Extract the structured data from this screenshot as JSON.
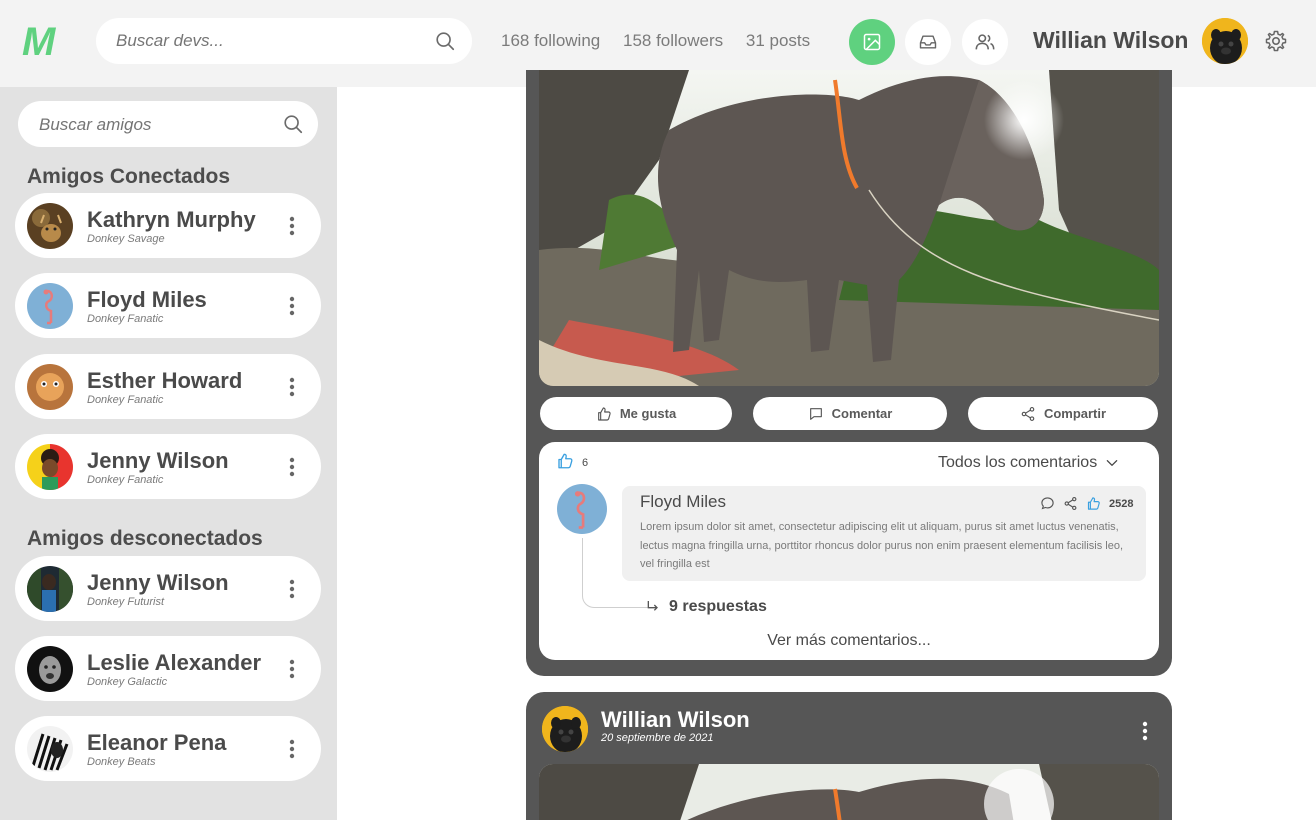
{
  "header": {
    "logo": "M",
    "search_placeholder": "Buscar devs...",
    "stats": {
      "following": "168 following",
      "followers": "158 followers",
      "posts": "31 posts"
    },
    "user_name": "Willian Wilson"
  },
  "sidebar": {
    "search_placeholder": "Buscar amigos",
    "connected_title": "Amigos Conectados",
    "disconnected_title": "Amigos desconectados",
    "connected": [
      {
        "name": "Kathryn Murphy",
        "subtitle": "Donkey Savage"
      },
      {
        "name": "Floyd Miles",
        "subtitle": "Donkey Fanatic"
      },
      {
        "name": "Esther Howard",
        "subtitle": "Donkey Fanatic"
      },
      {
        "name": "Jenny Wilson",
        "subtitle": "Donkey Fanatic"
      }
    ],
    "disconnected": [
      {
        "name": "Jenny Wilson",
        "subtitle": "Donkey Futurist"
      },
      {
        "name": "Leslie Alexander",
        "subtitle": "Donkey Galactic"
      },
      {
        "name": "Eleanor Pena",
        "subtitle": "Donkey Beats"
      }
    ]
  },
  "post1": {
    "actions": {
      "like": "Me gusta",
      "comment": "Comentar",
      "share": "Compartir"
    },
    "likes": "6",
    "all_comments": "Todos los comentarios",
    "comment": {
      "author": "Floyd Miles",
      "likes": "2528",
      "text": "Lorem ipsum dolor sit amet, consectetur adipiscing elit ut aliquam, purus sit amet luctus venenatis, lectus magna fringilla urna, porttitor rhoncus dolor purus non enim praesent elementum facilisis leo, vel fringilla est"
    },
    "replies": "9 respuestas",
    "more_comments": "Ver más comentarios..."
  },
  "post2": {
    "author": "Willian Wilson",
    "date": "20 septiembre de 2021"
  },
  "colors": {
    "accent": "#5fd17f",
    "post_bg": "#565656",
    "sidebar_bg": "#e2e2e2",
    "like_blue": "#3aa0e0"
  }
}
